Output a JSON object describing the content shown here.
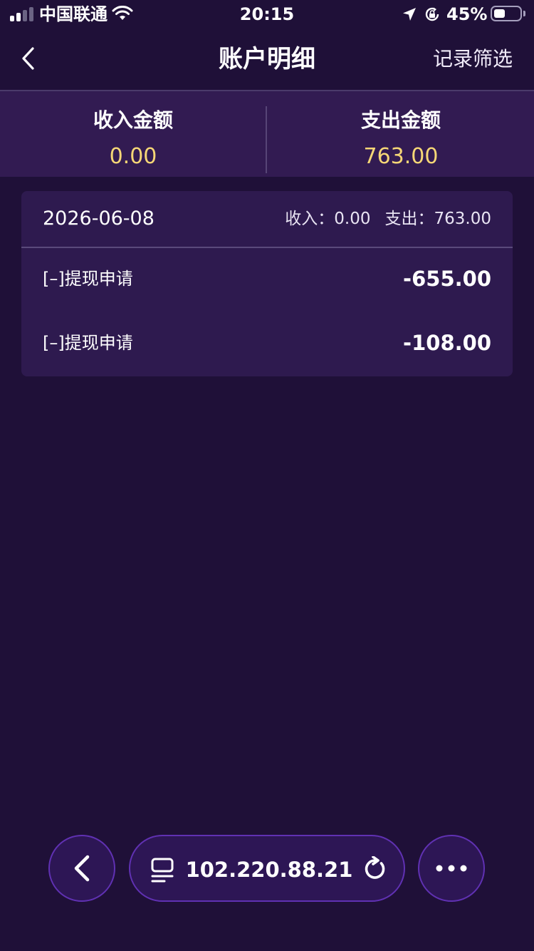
{
  "status_bar": {
    "carrier": "中国联通",
    "time": "20:15",
    "battery_text": "45%",
    "battery_level": 0.45,
    "icons": [
      "signal-icon",
      "wifi-icon",
      "location-icon",
      "rotation-lock-icon",
      "battery-icon"
    ]
  },
  "nav": {
    "title": "账户明细",
    "filter_label": "记录筛选",
    "back_icon": "chevron-left-icon"
  },
  "summary": {
    "income_label": "收入金额",
    "income_value": "0.00",
    "expense_label": "支出金额",
    "expense_value": "763.00"
  },
  "records": {
    "date": "2026-06-08",
    "income_text": "收入：0.00",
    "expense_text": "支出：763.00",
    "items": [
      {
        "name": "[–]提现申请",
        "amount": "-655.00"
      },
      {
        "name": "[–]提现申请",
        "amount": "-108.00"
      }
    ]
  },
  "browser": {
    "address": "102.220.88.21",
    "icons": [
      "back-icon",
      "tabs-icon",
      "reload-icon",
      "more-icon"
    ]
  },
  "colors": {
    "background": "#1f1038",
    "summary_bg": "#321b52",
    "card_bg": "#2e1a4f",
    "amount_highlight": "#f6d776",
    "toolbar_border": "#6031b3"
  }
}
